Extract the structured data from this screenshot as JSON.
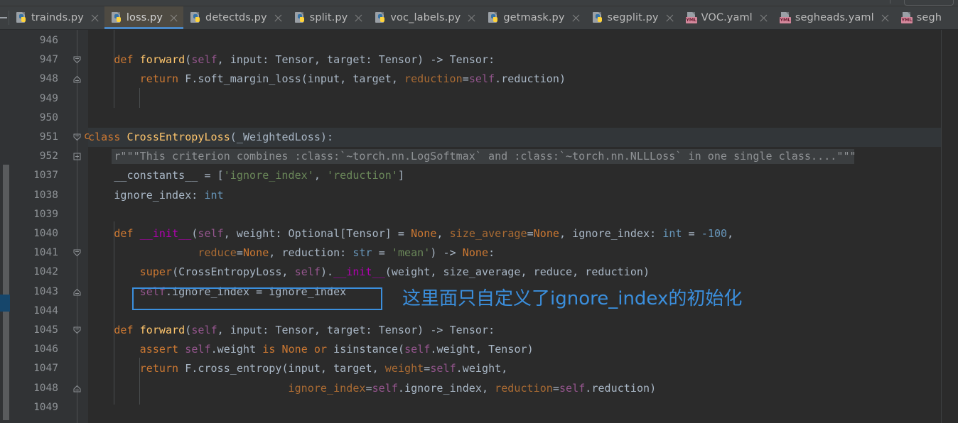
{
  "window": {
    "title_strip": ""
  },
  "tabs": [
    {
      "label": "trainds.py",
      "icon": "python-file-icon",
      "active": false
    },
    {
      "label": "loss.py",
      "icon": "python-file-icon",
      "active": true
    },
    {
      "label": "detectds.py",
      "icon": "python-file-icon",
      "active": false
    },
    {
      "label": "split.py",
      "icon": "python-file-icon",
      "active": false
    },
    {
      "label": "voc_labels.py",
      "icon": "python-file-icon",
      "active": false
    },
    {
      "label": "getmask.py",
      "icon": "python-file-icon",
      "active": false
    },
    {
      "label": "segplit.py",
      "icon": "python-file-icon",
      "active": false
    },
    {
      "label": "VOC.yaml",
      "icon": "yaml-file-icon",
      "active": false
    },
    {
      "label": "segheads.yaml",
      "icon": "yaml-file-icon",
      "active": false
    },
    {
      "label": "segh",
      "icon": "yaml-file-icon",
      "active": false
    }
  ],
  "yaml_badge_text": "YML",
  "editor": {
    "line_numbers": [
      "946",
      "947",
      "948",
      "949",
      "950",
      "951",
      "952",
      "1037",
      "1038",
      "1039",
      "1040",
      "1041",
      "1042",
      "1043",
      "1044",
      "1045",
      "1046",
      "1047",
      "1048",
      "1049"
    ],
    "lines": [
      {
        "num": "946",
        "text": ""
      },
      {
        "num": "947",
        "text": "    def forward(self, input: Tensor, target: Tensor) -> Tensor:"
      },
      {
        "num": "948",
        "text": "        return F.soft_margin_loss(input, target, reduction=self.reduction)"
      },
      {
        "num": "949",
        "text": ""
      },
      {
        "num": "950",
        "text": ""
      },
      {
        "num": "951",
        "text": "class CrossEntropyLoss(_WeightedLoss):"
      },
      {
        "num": "952",
        "text": "    r\"\"\"This criterion combines :class:`~torch.nn.LogSoftmax` and :class:`~torch.nn.NLLLoss` in one single class....\"\"\""
      },
      {
        "num": "1037",
        "text": "    __constants__ = ['ignore_index', 'reduction']"
      },
      {
        "num": "1038",
        "text": "    ignore_index: int"
      },
      {
        "num": "1039",
        "text": ""
      },
      {
        "num": "1040",
        "text": "    def __init__(self, weight: Optional[Tensor] = None, size_average=None, ignore_index: int = -100,"
      },
      {
        "num": "1041",
        "text": "                 reduce=None, reduction: str = 'mean') -> None:"
      },
      {
        "num": "1042",
        "text": "        super(CrossEntropyLoss, self).__init__(weight, size_average, reduce, reduction)"
      },
      {
        "num": "1043",
        "text": "        self.ignore_index = ignore_index"
      },
      {
        "num": "1044",
        "text": ""
      },
      {
        "num": "1045",
        "text": "    def forward(self, input: Tensor, target: Tensor) -> Tensor:"
      },
      {
        "num": "1046",
        "text": "        assert self.weight is None or isinstance(self.weight, Tensor)"
      },
      {
        "num": "1047",
        "text": "        return F.cross_entropy(input, target, weight=self.weight,"
      },
      {
        "num": "1048",
        "text": "                               ignore_index=self.ignore_index, reduction=self.reduction)"
      },
      {
        "num": "1049",
        "text": ""
      }
    ],
    "current_line": "1043",
    "fold_indicator_label": "c"
  },
  "annotation": {
    "boxed_code": "self.ignore_index = ignore_index",
    "text": "这里面只自定义了ignore_index的初始化",
    "color": "#3b8fdd"
  },
  "colors": {
    "editor_bg": "#2b2b2b",
    "gutter_bg": "#313335",
    "tabbar_bg": "#3c3f41",
    "active_tab_bg": "#4e4a42",
    "active_tab_underline": "#4a88c7",
    "keyword": "#cc7832",
    "function": "#ffc66d",
    "string": "#6a8759",
    "number": "#6897bb",
    "self_kw": "#94558d",
    "magic_fn": "#b200b2",
    "kwarg": "#aa6b33",
    "default_text": "#a9b7c6",
    "docstring": "#8f9295",
    "annotation_blue": "#3b8fdd"
  }
}
